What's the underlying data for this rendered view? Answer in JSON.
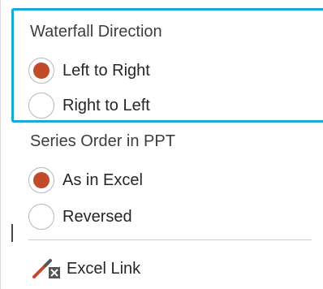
{
  "waterfall_direction": {
    "title": "Waterfall Direction",
    "options": [
      {
        "label": "Left to Right",
        "selected": true
      },
      {
        "label": "Right to Left",
        "selected": false
      }
    ]
  },
  "series_order": {
    "title": "Series Order in PPT",
    "options": [
      {
        "label": "As in Excel",
        "selected": true
      },
      {
        "label": "Reversed",
        "selected": false
      }
    ]
  },
  "excel_link": {
    "label": "Excel Link",
    "icon": "excel-link-icon"
  },
  "colors": {
    "focus": "#1aa8d8",
    "radio_selected": "#c14a2b",
    "divider": "#cfcfcf"
  }
}
